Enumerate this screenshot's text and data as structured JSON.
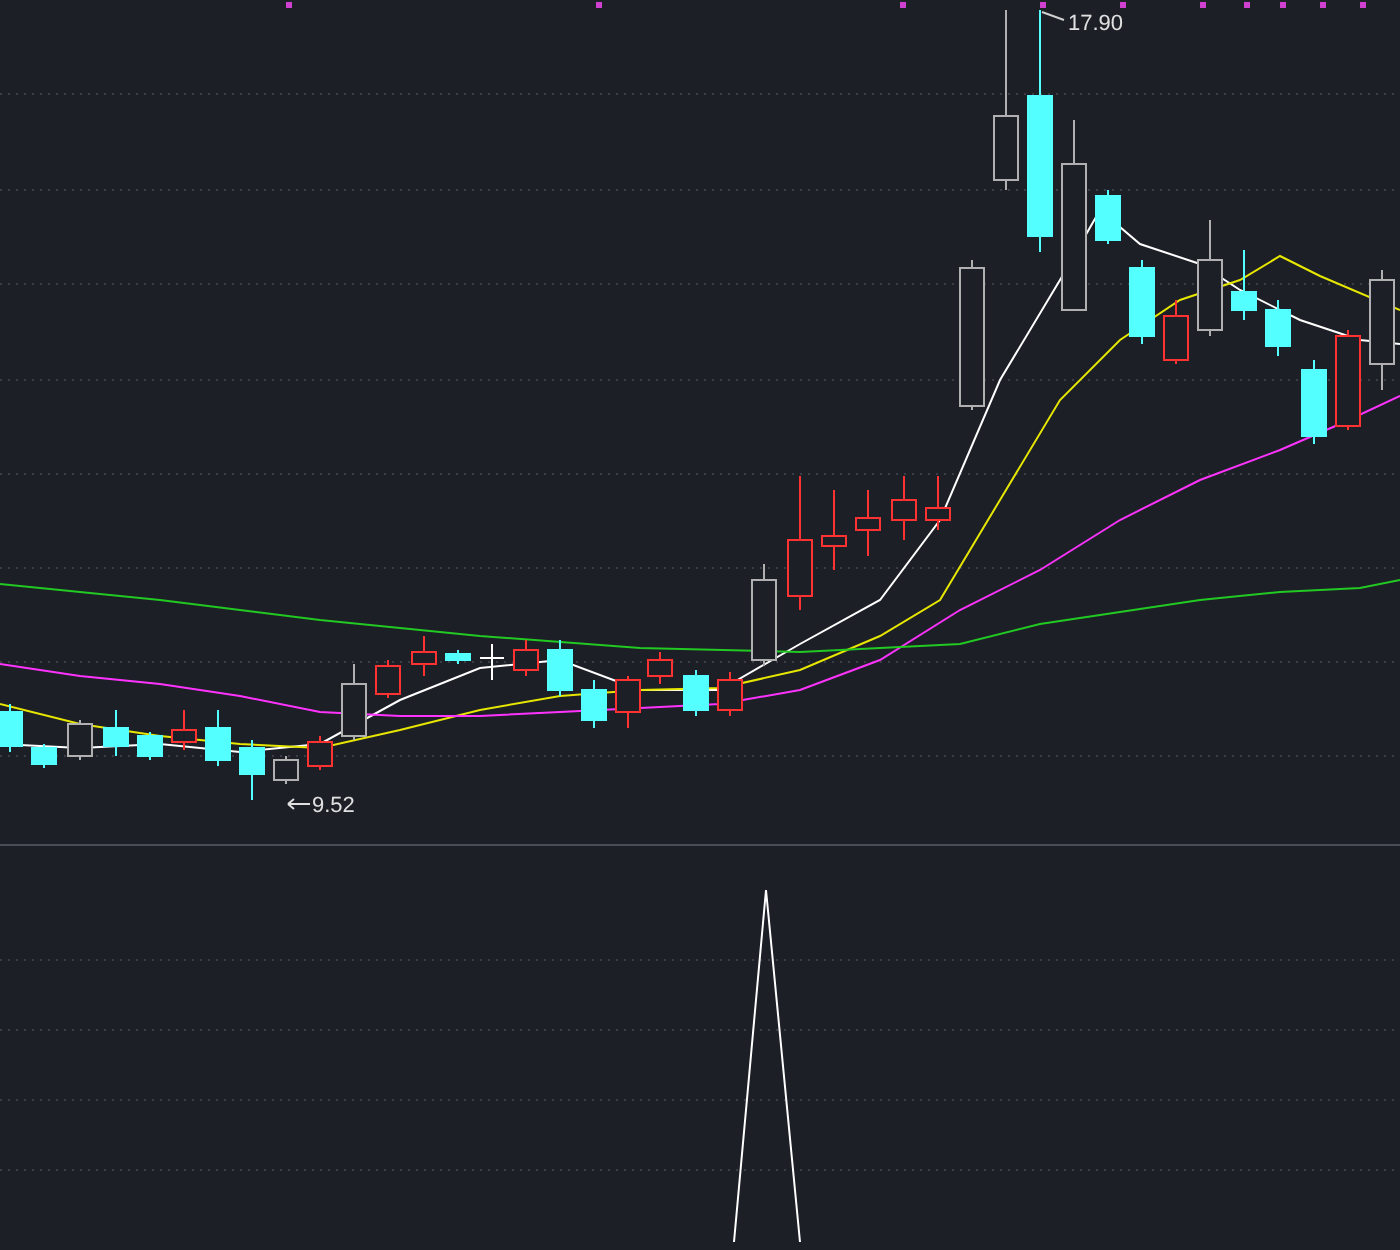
{
  "price_chart": {
    "high_marker": {
      "label": "17.90"
    },
    "low_marker": {
      "label": "9.52"
    }
  }
}
